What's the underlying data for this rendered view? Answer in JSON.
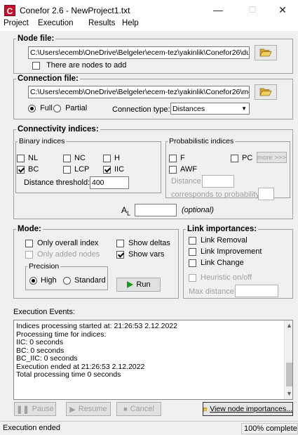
{
  "window": {
    "app_icon": "C",
    "title": "Conefor 2.6 - NewProject1.txt",
    "minimize": "—",
    "maximize": "☐",
    "close": "✕"
  },
  "menu": [
    "Project",
    "Execution",
    "Results",
    "Help"
  ],
  "node_file": {
    "legend": "Node file:",
    "path": "C:\\Users\\ecemb\\OneDrive\\Belgeler\\ecem-tez\\yakinlik\\Conefor26\\du",
    "nodes_to_add_label": "There are nodes to add",
    "nodes_to_add_checked": false
  },
  "connection_file": {
    "legend": "Connection file:",
    "path": "C:\\Users\\ecemb\\OneDrive\\Belgeler\\ecem-tez\\yakinlik\\Conefor26\\me",
    "full_label": "Full",
    "partial_label": "Partial",
    "selected": "Full",
    "type_label": "Connection type:",
    "type_value": "Distances"
  },
  "connectivity": {
    "legend": "Connectivity indices:",
    "binary_legend": "Binary indices",
    "binary": [
      {
        "label": "NL",
        "checked": false
      },
      {
        "label": "NC",
        "checked": false
      },
      {
        "label": "H",
        "checked": false
      },
      {
        "label": "BC",
        "checked": true
      },
      {
        "label": "LCP",
        "checked": false
      },
      {
        "label": "IIC",
        "checked": true
      }
    ],
    "distance_threshold_label": "Distance threshold:",
    "distance_threshold_value": "400",
    "prob_legend": "Probabilistic indices",
    "prob_f": "F",
    "prob_pc": "PC",
    "prob_awf": "AWF",
    "more_button": "more >>>",
    "distance_label": "Distance",
    "corresponds_label": "corresponds to probability",
    "al_label": "A",
    "al_sub": "L",
    "optional_label": "(optional)"
  },
  "mode": {
    "legend": "Mode:",
    "only_overall": "Only overall index",
    "only_added": "Only added nodes",
    "show_deltas": "Show deltas",
    "show_vars": "Show vars",
    "show_vars_checked": true,
    "precision_legend": "Precision",
    "high": "High",
    "standard": "Standard",
    "precision_selected": "High",
    "run_button": "Run"
  },
  "link_importances": {
    "legend": "Link importances:",
    "items": [
      "Link Removal",
      "Link Improvement",
      "Link Change"
    ],
    "heuristic": "Heuristic on/off",
    "max_distance": "Max distance:"
  },
  "events": {
    "label": "Execution Events:",
    "lines": [
      "Indices processing started at: 21:26:53 2.12.2022",
      "Processing time for indices:",
      "IIC: 0 seconds",
      "BC: 0 seconds",
      "BC_IIC: 0 seconds",
      "Execution ended at 21:26:53 2.12.2022",
      "Total processing time 0 seconds"
    ]
  },
  "controls": {
    "pause": "Pause",
    "resume": "Resume",
    "cancel": "Cancel",
    "view_node": "View node importances..."
  },
  "status": {
    "left": "Execution ended",
    "right": "100% complete"
  },
  "colors": {
    "run_arrow": "#1a9a1a",
    "app_icon": "#c8102e",
    "folder": "#e8b84a"
  }
}
